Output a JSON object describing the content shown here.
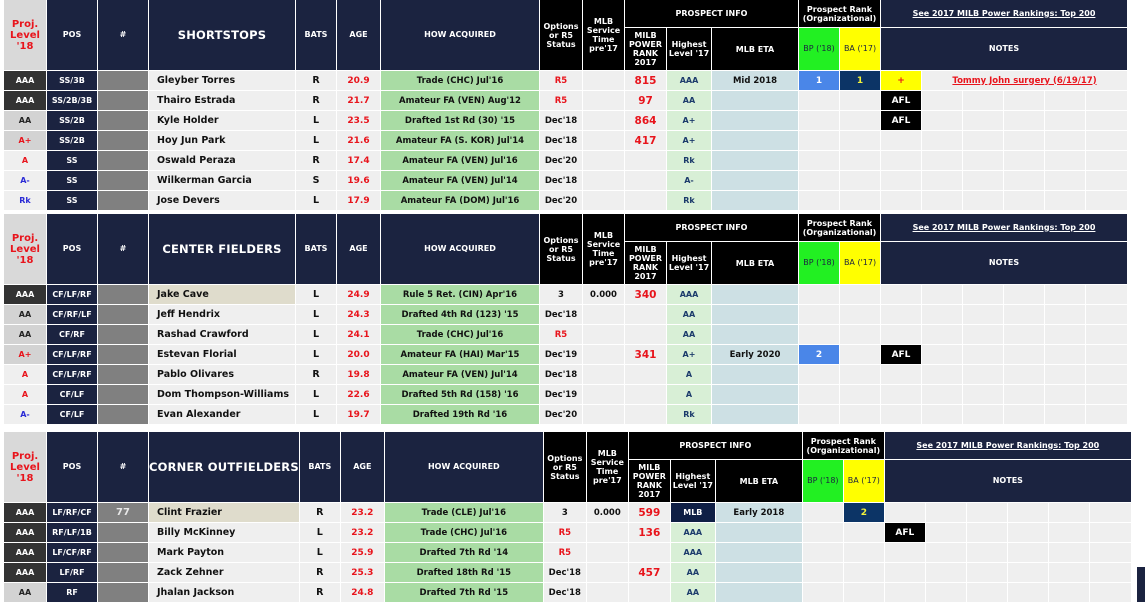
{
  "header_common": {
    "proj_level": "Proj. Level '18",
    "pos": "POS",
    "num": "#",
    "bats": "BATS",
    "age": "AGE",
    "how": "HOW ACQUIRED",
    "options": "Options or R5 Status",
    "service": "MLB Service Time pre'17",
    "prospect_info": "PROSPECT INFO",
    "power_rank": "MILB POWER RANK 2017",
    "highest": "Highest Level '17",
    "eta": "MLB ETA",
    "prospect_rank": "Prospect Rank (Organizational)",
    "bp": "BP ('18)",
    "ba": "BA ('17)",
    "rankings_link": "See 2017 MILB Power Rankings: Top 200",
    "notes": "NOTES"
  },
  "colors": {
    "navy": "#1b2340",
    "red": "#e8141c",
    "green_header": "#22f022",
    "yellow_header": "#ffff00",
    "acquired_green": "#a9dca4",
    "bp_blue": "#4a86e8",
    "ba_navy": "#0c3466"
  },
  "sections": [
    {
      "title": "SHORTSTOPS",
      "rows": [
        {
          "level": "AAA",
          "level_style": "dark",
          "pos": "SS/3B",
          "num": "",
          "name": "Gleyber Torres",
          "name_hl": false,
          "bats": "R",
          "age": "20.9",
          "how": "Trade (CHC) Jul'16",
          "options": "R5",
          "service": "",
          "rank": "815",
          "highest": "AAA",
          "eta": "Mid 2018",
          "bp": "1",
          "ba": "1",
          "tag": "+",
          "note": "Tommy John surgery (6/19/17)"
        },
        {
          "level": "AAA",
          "level_style": "dark",
          "pos": "SS/2B/3B",
          "num": "",
          "name": "Thairo Estrada",
          "name_hl": false,
          "bats": "R",
          "age": "21.7",
          "how": "Amateur FA (VEN) Aug'12",
          "options": "R5",
          "service": "",
          "rank": "97",
          "highest": "AA",
          "eta": "",
          "bp": "",
          "ba": "",
          "tag": "AFL",
          "note": ""
        },
        {
          "level": "AA",
          "level_style": "light",
          "pos": "SS/2B",
          "num": "",
          "name": "Kyle Holder",
          "name_hl": false,
          "bats": "L",
          "age": "23.5",
          "how": "Drafted 1st Rd (30) '15",
          "options": "Dec'18",
          "service": "",
          "rank": "864",
          "highest": "A+",
          "eta": "",
          "bp": "",
          "ba": "",
          "tag": "AFL",
          "note": ""
        },
        {
          "level": "A+",
          "level_style": "light-red",
          "pos": "SS/2B",
          "num": "",
          "name": "Hoy Jun Park",
          "name_hl": false,
          "bats": "L",
          "age": "21.6",
          "how": "Amateur FA (S. KOR) Jul'14",
          "options": "Dec'18",
          "service": "",
          "rank": "417",
          "highest": "A+",
          "eta": "",
          "bp": "",
          "ba": "",
          "tag": "",
          "note": ""
        },
        {
          "level": "A",
          "level_style": "red",
          "pos": "SS",
          "num": "",
          "name": "Oswald Peraza",
          "name_hl": false,
          "bats": "R",
          "age": "17.4",
          "how": "Amateur FA (VEN) Jul'16",
          "options": "Dec'20",
          "service": "",
          "rank": "",
          "highest": "Rk",
          "eta": "",
          "bp": "",
          "ba": "",
          "tag": "",
          "note": ""
        },
        {
          "level": "A-",
          "level_style": "blue",
          "pos": "SS",
          "num": "",
          "name": "Wilkerman Garcia",
          "name_hl": false,
          "bats": "S",
          "age": "19.6",
          "how": "Amateur FA (VEN) Jul'14",
          "options": "Dec'18",
          "service": "",
          "rank": "",
          "highest": "A-",
          "eta": "",
          "bp": "",
          "ba": "",
          "tag": "",
          "note": ""
        },
        {
          "level": "Rk",
          "level_style": "blue",
          "pos": "SS",
          "num": "",
          "name": "Jose Devers",
          "name_hl": false,
          "bats": "L",
          "age": "17.9",
          "how": "Amateur FA (DOM) Jul'16",
          "options": "Dec'20",
          "service": "",
          "rank": "",
          "highest": "Rk",
          "eta": "",
          "bp": "",
          "ba": "",
          "tag": "",
          "note": ""
        }
      ]
    },
    {
      "title": "CENTER FIELDERS",
      "rows": [
        {
          "level": "AAA",
          "level_style": "dark",
          "pos": "CF/LF/RF",
          "num": "",
          "name": "Jake Cave",
          "name_hl": true,
          "bats": "L",
          "age": "24.9",
          "how": "Rule 5 Ret. (CIN) Apr'16",
          "options": "3",
          "service": "0.000",
          "rank": "340",
          "highest": "AAA",
          "eta": "",
          "bp": "",
          "ba": "",
          "tag": "",
          "note": ""
        },
        {
          "level": "AA",
          "level_style": "light",
          "pos": "CF/RF/LF",
          "num": "",
          "name": "Jeff Hendrix",
          "name_hl": false,
          "bats": "L",
          "age": "24.3",
          "how": "Drafted 4th Rd (123) '15",
          "options": "Dec'18",
          "service": "",
          "rank": "",
          "highest": "AA",
          "eta": "",
          "bp": "",
          "ba": "",
          "tag": "",
          "note": ""
        },
        {
          "level": "AA",
          "level_style": "light",
          "pos": "CF/RF",
          "num": "",
          "name": "Rashad Crawford",
          "name_hl": false,
          "bats": "L",
          "age": "24.1",
          "how": "Trade (CHC) Jul'16",
          "options": "R5",
          "service": "",
          "rank": "",
          "highest": "AA",
          "eta": "",
          "bp": "",
          "ba": "",
          "tag": "",
          "note": ""
        },
        {
          "level": "A+",
          "level_style": "light-red",
          "pos": "CF/LF/RF",
          "num": "",
          "name": "Estevan Florial",
          "name_hl": false,
          "bats": "L",
          "age": "20.0",
          "how": "Amateur FA (HAI) Mar'15",
          "options": "Dec'19",
          "service": "",
          "rank": "341",
          "highest": "A+",
          "eta": "Early 2020",
          "bp": "2",
          "ba": "",
          "tag": "AFL",
          "note": ""
        },
        {
          "level": "A",
          "level_style": "red",
          "pos": "CF/LF/RF",
          "num": "",
          "name": "Pablo Olivares",
          "name_hl": false,
          "bats": "R",
          "age": "19.8",
          "how": "Amateur FA (VEN) Jul'14",
          "options": "Dec'18",
          "service": "",
          "rank": "",
          "highest": "A",
          "eta": "",
          "bp": "",
          "ba": "",
          "tag": "",
          "note": ""
        },
        {
          "level": "A",
          "level_style": "red",
          "pos": "CF/LF",
          "num": "",
          "name": "Dom Thompson-Williams",
          "name_hl": false,
          "bats": "L",
          "age": "22.6",
          "how": "Drafted 5th Rd (158) '16",
          "options": "Dec'19",
          "service": "",
          "rank": "",
          "highest": "A",
          "eta": "",
          "bp": "",
          "ba": "",
          "tag": "",
          "note": ""
        },
        {
          "level": "A-",
          "level_style": "blue",
          "pos": "CF/LF",
          "num": "",
          "name": "Evan Alexander",
          "name_hl": false,
          "bats": "L",
          "age": "19.7",
          "how": "Drafted 19th Rd '16",
          "options": "Dec'20",
          "service": "",
          "rank": "",
          "highest": "Rk",
          "eta": "",
          "bp": "",
          "ba": "",
          "tag": "",
          "note": ""
        }
      ]
    },
    {
      "title": "CORNER OUTFIELDERS",
      "rows": [
        {
          "level": "AAA",
          "level_style": "dark",
          "pos": "LF/RF/CF",
          "num": "77",
          "name": "Clint Frazier",
          "name_hl": true,
          "bats": "R",
          "age": "23.2",
          "how": "Trade (CLE) Jul'16",
          "options": "3",
          "service": "0.000",
          "rank": "599",
          "highest": "MLB",
          "eta": "Early 2018",
          "bp": "",
          "ba": "2",
          "tag": "",
          "note": ""
        },
        {
          "level": "AAA",
          "level_style": "dark",
          "pos": "RF/LF/1B",
          "num": "",
          "name": "Billy McKinney",
          "name_hl": false,
          "bats": "L",
          "age": "23.2",
          "how": "Trade (CHC) Jul'16",
          "options": "R5",
          "service": "",
          "rank": "136",
          "highest": "AAA",
          "eta": "",
          "bp": "",
          "ba": "",
          "tag": "AFL",
          "note": ""
        },
        {
          "level": "AAA",
          "level_style": "dark",
          "pos": "LF/CF/RF",
          "num": "",
          "name": "Mark Payton",
          "name_hl": false,
          "bats": "L",
          "age": "25.9",
          "how": "Drafted 7th Rd '14",
          "options": "R5",
          "service": "",
          "rank": "",
          "highest": "AAA",
          "eta": "",
          "bp": "",
          "ba": "",
          "tag": "",
          "note": ""
        },
        {
          "level": "AAA",
          "level_style": "dark",
          "pos": "LF/RF",
          "num": "",
          "name": "Zack Zehner",
          "name_hl": false,
          "bats": "R",
          "age": "25.3",
          "how": "Drafted 18th Rd '15",
          "options": "Dec'18",
          "service": "",
          "rank": "457",
          "highest": "AA",
          "eta": "",
          "bp": "",
          "ba": "",
          "tag": "",
          "note": ""
        },
        {
          "level": "AA",
          "level_style": "light",
          "pos": "RF",
          "num": "",
          "name": "Jhalan Jackson",
          "name_hl": false,
          "bats": "R",
          "age": "24.8",
          "how": "Drafted 7th Rd '15",
          "options": "Dec'18",
          "service": "",
          "rank": "",
          "highest": "AA",
          "eta": "",
          "bp": "",
          "ba": "",
          "tag": "",
          "note": ""
        }
      ]
    }
  ]
}
